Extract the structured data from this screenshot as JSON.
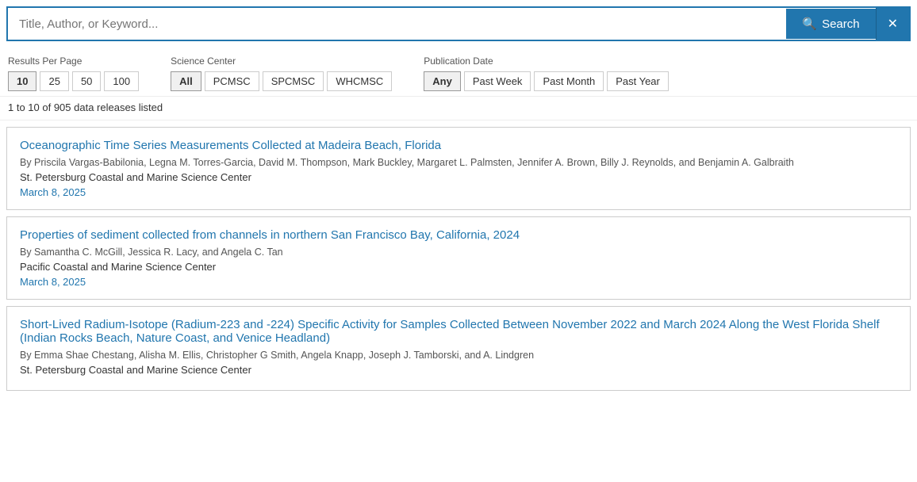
{
  "search": {
    "placeholder": "Title, Author, or Keyword...",
    "button_label": "Search",
    "clear_icon": "✕"
  },
  "filters": {
    "results_per_page": {
      "label": "Results Per Page",
      "options": [
        "10",
        "25",
        "50",
        "100"
      ],
      "active": "10"
    },
    "science_center": {
      "label": "Science Center",
      "options": [
        "All",
        "PCMSC",
        "SPCMSC",
        "WHCMSC"
      ],
      "active": "All"
    },
    "publication_date": {
      "label": "Publication Date",
      "options": [
        "Any",
        "Past Week",
        "Past Month",
        "Past Year"
      ],
      "active": "Any"
    }
  },
  "results_summary": "1 to 10 of 905 data releases listed",
  "results": [
    {
      "title": "Oceanographic Time Series Measurements Collected at Madeira Beach, Florida",
      "authors": "By Priscila Vargas-Babilonia, Legna M. Torres-Garcia, David M. Thompson, Mark Buckley, Margaret L. Palmsten, Jennifer A. Brown, Billy J. Reynolds, and Benjamin A. Galbraith",
      "center": "St. Petersburg Coastal and Marine Science Center",
      "date": "March 8, 2025"
    },
    {
      "title": "Properties of sediment collected from channels in northern San Francisco Bay, California, 2024",
      "authors": "By Samantha C. McGill, Jessica R. Lacy, and Angela C. Tan",
      "center": "Pacific Coastal and Marine Science Center",
      "date": "March 8, 2025"
    },
    {
      "title": "Short-Lived Radium-Isotope (Radium-223 and -224) Specific Activity for Samples Collected Between November 2022 and March 2024 Along the West Florida Shelf (Indian Rocks Beach, Nature Coast, and Venice Headland)",
      "authors": "By Emma Shae Chestang, Alisha M. Ellis, Christopher G Smith, Angela Knapp, Joseph J. Tamborski, and A. Lindgren",
      "center": "St. Petersburg Coastal and Marine Science Center",
      "date": ""
    }
  ]
}
